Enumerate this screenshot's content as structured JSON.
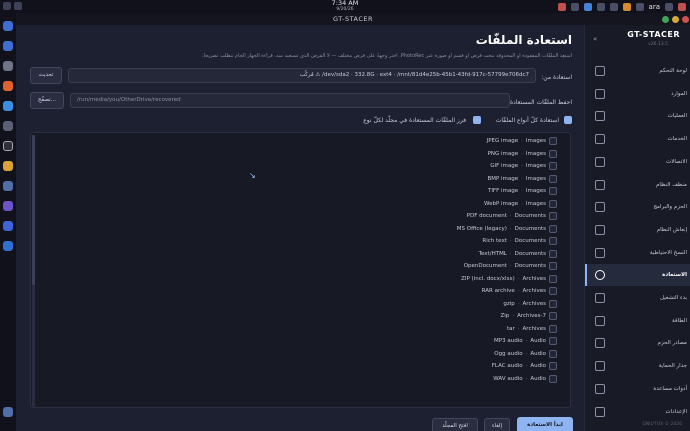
{
  "system": {
    "time": "7:34 AM",
    "date": "9/20/26",
    "lang": "ara"
  },
  "window": {
    "title": "GT-STACER"
  },
  "page": {
    "title": "استعادة الملفّات",
    "description": "استعِد الملفّات المفقودة أو المحذوفة بنحت قرص أو قسم أو صورة عبر PhotoRec. اختر وجهةً على قرص مختلف — لا القرص الذي تستعيد منه. قراءة الجهاز الخام تتطلّب تصريحاً."
  },
  "source": {
    "label": "استعادة من:",
    "value": "dev/sda2 · 332.8G · ext4 · /mnt/81d4e25b-45b1-43fd-917c-57799e706dc7/ ⚠ مُركّب",
    "refresh_label": "تحديث"
  },
  "dest": {
    "label": "احفظ الملفّات المستعادة في:",
    "value": "/run/media/you/OtherDrive/recovered",
    "browse_label": "تصفّح..."
  },
  "options": {
    "recover_all_label": "استعادة كلّ أنواع الملفّات",
    "recover_all_checked": true,
    "sort_label": "فرز الملفّات المستعادة في مجلّد لكلّ نوع",
    "sort_checked": true
  },
  "file_types": [
    {
      "name": "JPEG image",
      "category": "Images"
    },
    {
      "name": "PNG image",
      "category": "Images"
    },
    {
      "name": "GIF image",
      "category": "Images"
    },
    {
      "name": "BMP image",
      "category": "Images"
    },
    {
      "name": "TIFF image",
      "category": "Images"
    },
    {
      "name": "WebP image",
      "category": "Images"
    },
    {
      "name": "PDF document",
      "category": "Documents"
    },
    {
      "name": "MS Office (legacy)",
      "category": "Documents"
    },
    {
      "name": "Rich text",
      "category": "Documents"
    },
    {
      "name": "Text/HTML",
      "category": "Documents"
    },
    {
      "name": "OpenDocument",
      "category": "Documents"
    },
    {
      "name": "ZIP (incl. docx/xlsx)",
      "category": "Archives"
    },
    {
      "name": "RAR archive",
      "category": "Archives"
    },
    {
      "name": "gzip",
      "category": "Archives"
    },
    {
      "name": "Zip",
      "category": "Archives-7"
    },
    {
      "name": "tar",
      "category": "Archives"
    },
    {
      "name": "MP3 audio",
      "category": "Audio"
    },
    {
      "name": "Ogg audio",
      "category": "Audio"
    },
    {
      "name": "FLAC audio",
      "category": "Audio"
    },
    {
      "name": "WAV audio",
      "category": "Audio"
    }
  ],
  "actions": {
    "start_label": "ابدأ الاستعادة",
    "cancel_label": "إلغاء",
    "open_folder_label": "افتح المجلّد"
  },
  "sidebar": {
    "brand": "GT-STACER",
    "version": "v26.13.5",
    "collapse": "«",
    "items": [
      {
        "label": "لوحة التحكم"
      },
      {
        "label": "الموارد"
      },
      {
        "label": "العمليات"
      },
      {
        "label": "الخدمات"
      },
      {
        "label": "الاتصالات"
      },
      {
        "label": "منظف النظام"
      },
      {
        "label": "الحزم والبرامج"
      },
      {
        "label": "إنعاش النظام"
      },
      {
        "label": "النسخ الاحتياطية"
      },
      {
        "label": "الاستعادة"
      },
      {
        "label": "بدء التشغيل"
      },
      {
        "label": "الطاقة"
      },
      {
        "label": "مصادر الحزم"
      },
      {
        "label": "جدار الحماية"
      },
      {
        "label": "أدوات مساعدة"
      },
      {
        "label": "الإعدادات"
      }
    ],
    "active_index": 9,
    "copyright": "GNU/TUX © 2026"
  }
}
